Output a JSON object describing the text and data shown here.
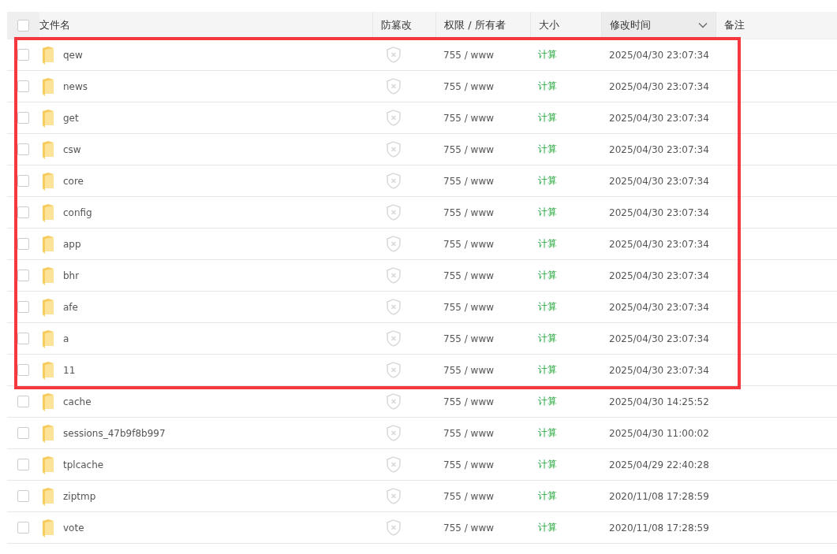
{
  "table": {
    "all_checked": false,
    "columns": [
      {
        "label": "文件名",
        "sorted": false
      },
      {
        "label": "防篡改",
        "sorted": false
      },
      {
        "label": "权限 / 所有者",
        "sorted": false
      },
      {
        "label": "大小",
        "sorted": false
      },
      {
        "label": "修改时间",
        "sorted": true
      },
      {
        "label": "备注",
        "sorted": false
      }
    ],
    "groups": [
      {
        "highlighted": true,
        "rows": [
          {
            "name": "qew",
            "perm": "755 / www",
            "size": "计算",
            "mtime": "2025/04/30 23:07:34",
            "checked": false
          },
          {
            "name": "news",
            "perm": "755 / www",
            "size": "计算",
            "mtime": "2025/04/30 23:07:34",
            "checked": false
          },
          {
            "name": "get",
            "perm": "755 / www",
            "size": "计算",
            "mtime": "2025/04/30 23:07:34",
            "checked": false
          },
          {
            "name": "csw",
            "perm": "755 / www",
            "size": "计算",
            "mtime": "2025/04/30 23:07:34",
            "checked": false
          },
          {
            "name": "core",
            "perm": "755 / www",
            "size": "计算",
            "mtime": "2025/04/30 23:07:34",
            "checked": false
          },
          {
            "name": "config",
            "perm": "755 / www",
            "size": "计算",
            "mtime": "2025/04/30 23:07:34",
            "checked": false
          },
          {
            "name": "app",
            "perm": "755 / www",
            "size": "计算",
            "mtime": "2025/04/30 23:07:34",
            "checked": false
          },
          {
            "name": "bhr",
            "perm": "755 / www",
            "size": "计算",
            "mtime": "2025/04/30 23:07:34",
            "checked": false
          },
          {
            "name": "afe",
            "perm": "755 / www",
            "size": "计算",
            "mtime": "2025/04/30 23:07:34",
            "checked": false
          },
          {
            "name": "a",
            "perm": "755 / www",
            "size": "计算",
            "mtime": "2025/04/30 23:07:34",
            "checked": false
          },
          {
            "name": "11",
            "perm": "755 / www",
            "size": "计算",
            "mtime": "2025/04/30 23:07:34",
            "checked": false
          }
        ]
      },
      {
        "highlighted": false,
        "rows": [
          {
            "name": "cache",
            "perm": "755 / www",
            "size": "计算",
            "mtime": "2025/04/30 14:25:52",
            "checked": false
          },
          {
            "name": "sessions_47b9f8b997",
            "perm": "755 / www",
            "size": "计算",
            "mtime": "2025/04/30 11:00:02",
            "checked": false
          },
          {
            "name": "tplcache",
            "perm": "755 / www",
            "size": "计算",
            "mtime": "2025/04/29 22:40:28",
            "checked": false
          },
          {
            "name": "ziptmp",
            "perm": "755 / www",
            "size": "计算",
            "mtime": "2020/11/08 17:28:59",
            "checked": false
          },
          {
            "name": "vote",
            "perm": "755 / www",
            "size": "计算",
            "mtime": "2020/11/08 17:28:59",
            "checked": false
          }
        ]
      }
    ]
  }
}
